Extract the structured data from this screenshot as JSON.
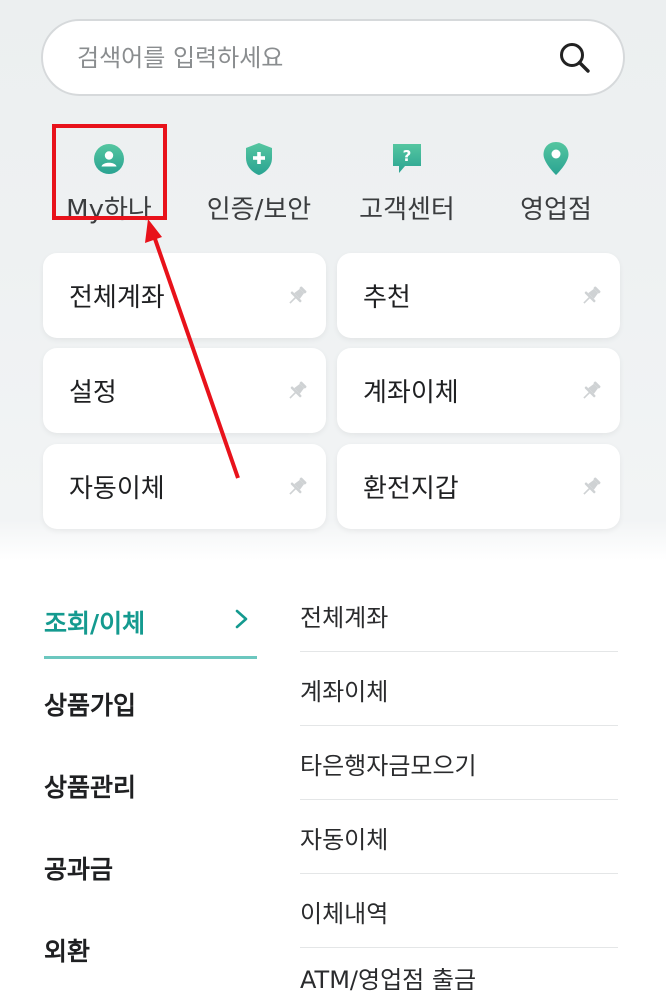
{
  "search": {
    "placeholder": "검색어를 입력하세요",
    "icon": "search-icon"
  },
  "quick_menu": [
    {
      "label": "My하나",
      "icon": "person-icon"
    },
    {
      "label": "인증/보안",
      "icon": "shield-icon"
    },
    {
      "label": "고객센터",
      "icon": "help-chat-icon"
    },
    {
      "label": "영업점",
      "icon": "location-pin-icon"
    }
  ],
  "favorites": [
    {
      "label": "전체계좌"
    },
    {
      "label": "추천"
    },
    {
      "label": "설정"
    },
    {
      "label": "계좌이체"
    },
    {
      "label": "자동이체"
    },
    {
      "label": "환전지갑"
    }
  ],
  "categories": [
    {
      "label": "조회/이체",
      "active": true
    },
    {
      "label": "상품가입"
    },
    {
      "label": "상품관리"
    },
    {
      "label": "공과금"
    },
    {
      "label": "외환"
    }
  ],
  "submenu": [
    {
      "label": "전체계좌"
    },
    {
      "label": "계좌이체"
    },
    {
      "label": "타은행자금모으기"
    },
    {
      "label": "자동이체"
    },
    {
      "label": "이체내역"
    },
    {
      "label": "ATM/영업점 출금"
    }
  ],
  "colors": {
    "accent": "#149a8f",
    "icon_green": "#3dbb95",
    "highlight": "#e8121b"
  }
}
